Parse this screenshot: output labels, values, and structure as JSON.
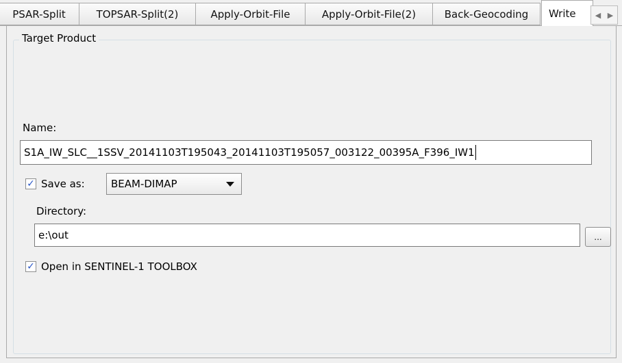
{
  "tabs": [
    {
      "label": "PSAR-Split"
    },
    {
      "label": "TOPSAR-Split(2)"
    },
    {
      "label": "Apply-Orbit-File"
    },
    {
      "label": "Apply-Orbit-File(2)"
    },
    {
      "label": "Back-Geocoding"
    },
    {
      "label": "Write",
      "active": true
    }
  ],
  "tab_scroll": {
    "left_icon": "chevron-left-icon",
    "right_icon": "chevron-right-icon"
  },
  "group": {
    "title": "Target Product"
  },
  "name_section": {
    "label": "Name:",
    "value": "S1A_IW_SLC__1SSV_20141103T195043_20141103T195057_003122_00395A_F396_IW1"
  },
  "save_as": {
    "checked": true,
    "label": "Save as:",
    "format": "BEAM-DIMAP"
  },
  "directory": {
    "label": "Directory:",
    "value": "e:\\out",
    "browse_label": "..."
  },
  "open_in": {
    "checked": true,
    "label": "Open in SENTINEL-1 TOOLBOX"
  },
  "colors": {
    "check": "#2b58c7",
    "border": "#a9a9a9",
    "background": "#f0f0f0"
  }
}
